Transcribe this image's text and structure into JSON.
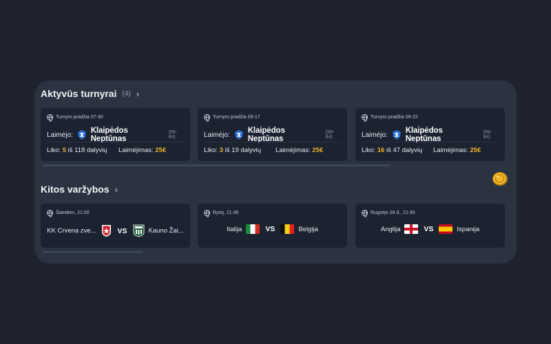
{
  "active_tournaments": {
    "title": "Aktyvūs turnyrai",
    "count": "(4)",
    "chevron": "›",
    "cards": [
      {
        "start": "Turnyro pradžia 07-30",
        "winner_label": "Laimėjo:",
        "team": "Klaipėdos Neptūnas",
        "score": "(99-84)",
        "left_label": "Liko:",
        "left_value": "5",
        "left_suffix": "iš 118 dalyvių",
        "prize_label": "Laimėjimas:",
        "prize_value": "25€"
      },
      {
        "start": "Turnyro pradžia 09-17",
        "winner_label": "Laimėjo:",
        "team": "Klaipėdos Neptūnas",
        "score": "(99-84)",
        "left_label": "Liko:",
        "left_value": "3",
        "left_suffix": "iš 19 dalyvių",
        "prize_label": "Laimėjimas:",
        "prize_value": "25€"
      },
      {
        "start": "Turnyro pradžia 09-22",
        "winner_label": "Laimėjo:",
        "team": "Klaipėdos Neptūnas",
        "score": "(99-84)",
        "left_label": "Liko:",
        "left_value": "16",
        "left_suffix": "iš 47 dalyvių",
        "prize_label": "Laimėjimas:",
        "prize_value": "25€"
      }
    ]
  },
  "other_events": {
    "title": "Kitos varžybos",
    "chevron": "›",
    "cards": [
      {
        "time": "Šiandien, 21:00",
        "home": "KK Crvena zve...",
        "vs": "VS",
        "away": "Kauno Žai..."
      },
      {
        "time": "Rytoj, 21:45",
        "home": "Italija",
        "vs": "VS",
        "away": "Belgija"
      },
      {
        "time": "Rugsėjo 26 d., 21:45",
        "home": "Anglija",
        "vs": "VS",
        "away": "Ispanija"
      }
    ]
  },
  "colors": {
    "background": "#1e232e",
    "panel": "#2b3340",
    "card": "#1b2230",
    "highlight": "#f4b32a"
  },
  "icons": {
    "sport": "basketball-icon",
    "football": "football-icon",
    "coin": "coin-icon"
  }
}
